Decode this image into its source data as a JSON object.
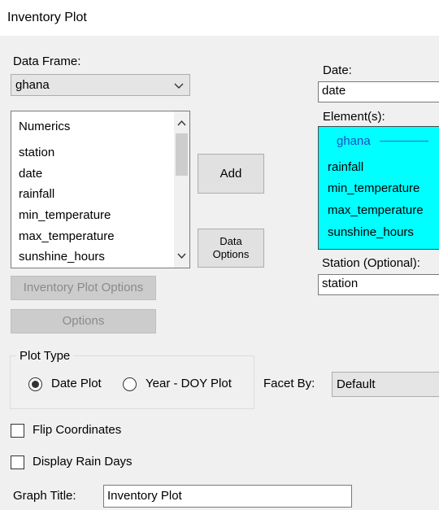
{
  "window": {
    "title": "Inventory Plot"
  },
  "data_frame": {
    "label": "Data Frame:",
    "selected": "ghana",
    "icon": "chevron-down-icon"
  },
  "selector_list": {
    "header": "Numerics",
    "items": [
      "station",
      "date",
      "rainfall",
      "min_temperature",
      "max_temperature",
      "sunshine_hours"
    ]
  },
  "buttons": {
    "add": "Add",
    "data_options_line1": "Data",
    "data_options_line2": "Options",
    "inventory_plot_options": "Inventory Plot Options",
    "options": "Options"
  },
  "date": {
    "label": "Date:",
    "value": "date"
  },
  "elements": {
    "label": "Element(s):",
    "group": "ghana",
    "items": [
      "rainfall",
      "min_temperature",
      "max_temperature",
      "sunshine_hours"
    ]
  },
  "station": {
    "label": "Station (Optional):",
    "value": "station"
  },
  "plot_type": {
    "label": "Plot Type",
    "options": [
      {
        "label": "Date Plot",
        "checked": true
      },
      {
        "label": "Year - DOY Plot",
        "checked": false
      }
    ]
  },
  "facet_by": {
    "label": "Facet By:",
    "selected": "Default"
  },
  "checkboxes": {
    "flip_coordinates": {
      "label": "Flip Coordinates",
      "checked": false
    },
    "display_rain_days": {
      "label": "Display Rain Days",
      "checked": false
    }
  },
  "graph_title": {
    "label": "Graph Title:",
    "value": "Inventory Plot"
  },
  "colors": {
    "receiver_bg": "#00ffff",
    "group_header": "#1e50c8",
    "disabled_button": "#cccccc"
  }
}
